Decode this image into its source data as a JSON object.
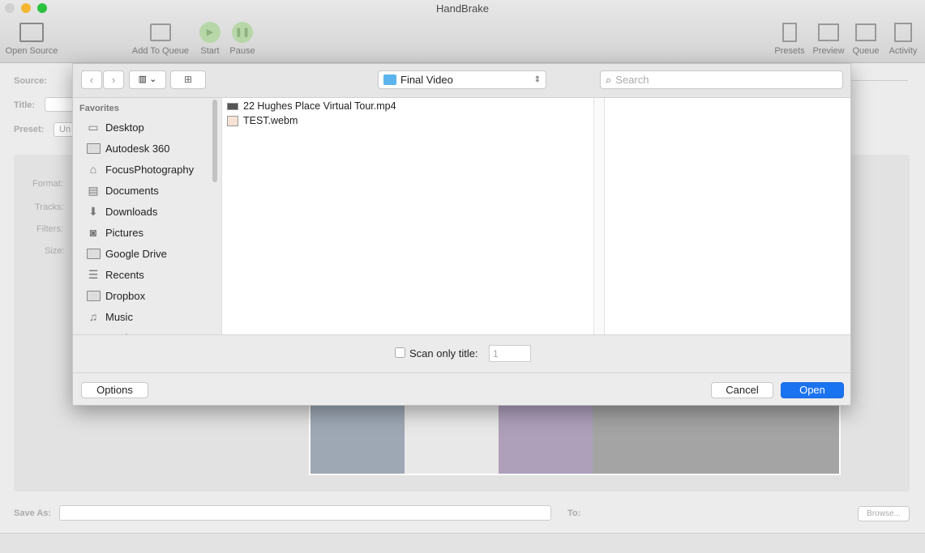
{
  "window": {
    "title": "HandBrake"
  },
  "toolbar": {
    "open_source": "Open Source",
    "add_to_queue": "Add To Queue",
    "start": "Start",
    "pause": "Pause",
    "presets": "Presets",
    "preview": "Preview",
    "queue": "Queue",
    "activity": "Activity"
  },
  "main": {
    "source_label": "Source:",
    "title_label": "Title:",
    "preset_label": "Preset:",
    "preset_value": "Un",
    "format_label": "Format:",
    "tracks_label": "Tracks:",
    "filters_label": "Filters:",
    "size_label": "Size:",
    "save_as_label": "Save As:",
    "save_as_value": "",
    "to_label": "To:",
    "browse": "Browse..."
  },
  "dialog": {
    "location": "Final Video",
    "search_placeholder": "Search",
    "sidebar_header": "Favorites",
    "sidebar": [
      {
        "label": "Desktop",
        "icon": "desktop-icon"
      },
      {
        "label": "Autodesk 360",
        "icon": "folder-icon"
      },
      {
        "label": "FocusPhotography",
        "icon": "home-icon"
      },
      {
        "label": "Documents",
        "icon": "documents-icon"
      },
      {
        "label": "Downloads",
        "icon": "downloads-icon"
      },
      {
        "label": "Pictures",
        "icon": "camera-icon"
      },
      {
        "label": "Google Drive",
        "icon": "folder-icon"
      },
      {
        "label": "Recents",
        "icon": "recents-icon"
      },
      {
        "label": "Dropbox",
        "icon": "folder-icon"
      },
      {
        "label": "Music",
        "icon": "music-icon"
      },
      {
        "label": "Movies",
        "icon": "movies-icon"
      }
    ],
    "files": [
      {
        "name": "22 Hughes Place Virtual Tour.mp4"
      },
      {
        "name": "TEST.webm"
      }
    ],
    "scan_only_title_label": "Scan only title:",
    "scan_only_title_value": "1",
    "options": "Options",
    "cancel": "Cancel",
    "open": "Open"
  },
  "colors": {
    "accent": "#1a73f0"
  }
}
